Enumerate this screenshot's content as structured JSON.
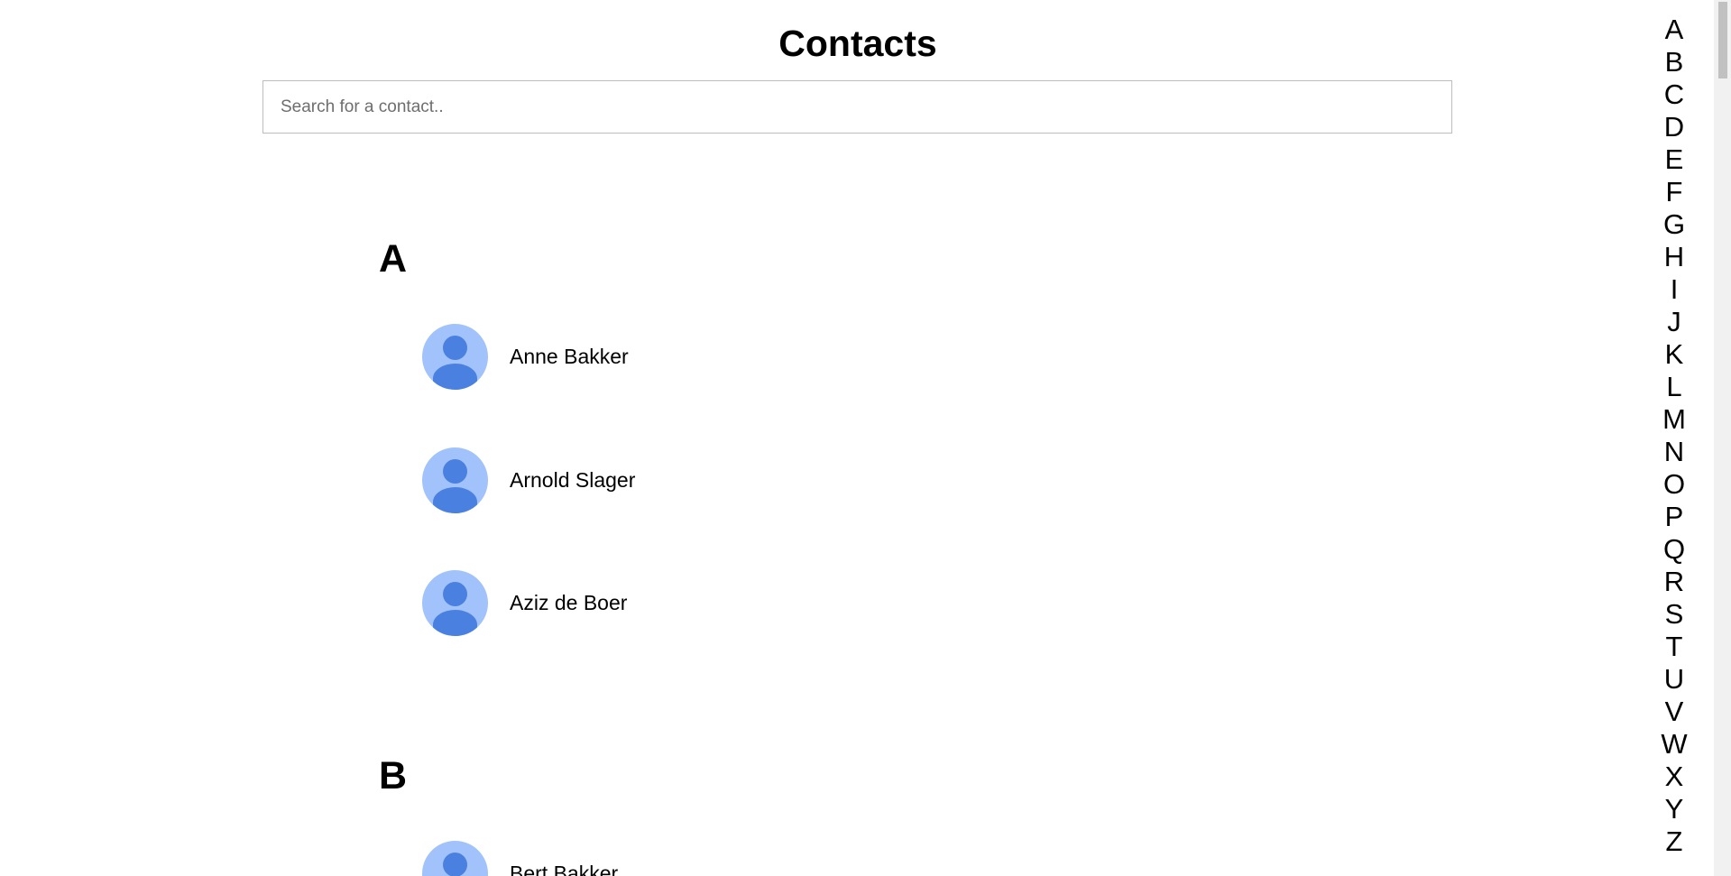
{
  "header": {
    "title": "Contacts"
  },
  "search": {
    "placeholder": "Search for a contact.."
  },
  "sections": [
    {
      "letter": "A",
      "contacts": [
        {
          "name": "Anne Bakker",
          "icon": "person-icon"
        },
        {
          "name": "Arnold Slager",
          "icon": "person-icon"
        },
        {
          "name": "Aziz de Boer",
          "icon": "person-icon"
        }
      ]
    },
    {
      "letter": "B",
      "contacts": [
        {
          "name": "Bert Bakker",
          "icon": "person-icon"
        }
      ]
    }
  ],
  "alphabet_index": [
    "A",
    "B",
    "C",
    "D",
    "E",
    "F",
    "G",
    "H",
    "I",
    "J",
    "K",
    "L",
    "M",
    "N",
    "O",
    "P",
    "Q",
    "R",
    "S",
    "T",
    "U",
    "V",
    "W",
    "X",
    "Y",
    "Z"
  ],
  "colors": {
    "avatar_bg": "#a1c2fa",
    "avatar_fg": "#4a80e0"
  }
}
